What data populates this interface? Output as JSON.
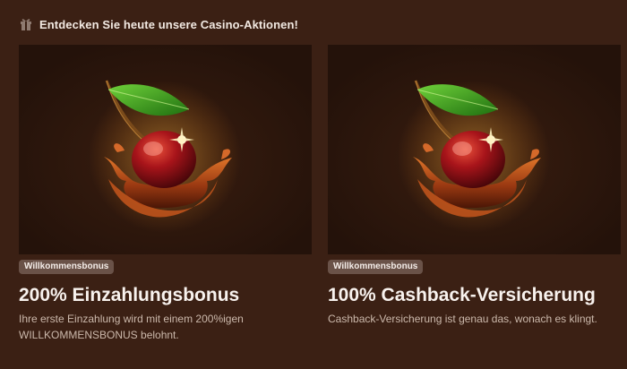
{
  "header": {
    "icon": "gift-icon",
    "title": "Entdecken Sie heute unsere Casino-Aktionen!"
  },
  "promotions": [
    {
      "image": "cherry-splash-illustration",
      "badge": "Willkommensbonus",
      "title": "200% Einzahlungsbonus",
      "description": "Ihre erste Einzahlung wird mit einem 200%igen WILLKOMMENSBONUS belohnt."
    },
    {
      "image": "cherry-splash-illustration",
      "badge": "Willkommensbonus",
      "title": "100% Cashback-Versicherung",
      "description": "Cashback-Versicherung ist genau das, wonach es klingt."
    }
  ],
  "colors": {
    "background": "#3b2014",
    "card_image_bg": "#2c160c",
    "badge_bg": "#6a5248",
    "cherry": "#9e1418",
    "leaf": "#3fa21a",
    "glow": "#ffd26a"
  }
}
